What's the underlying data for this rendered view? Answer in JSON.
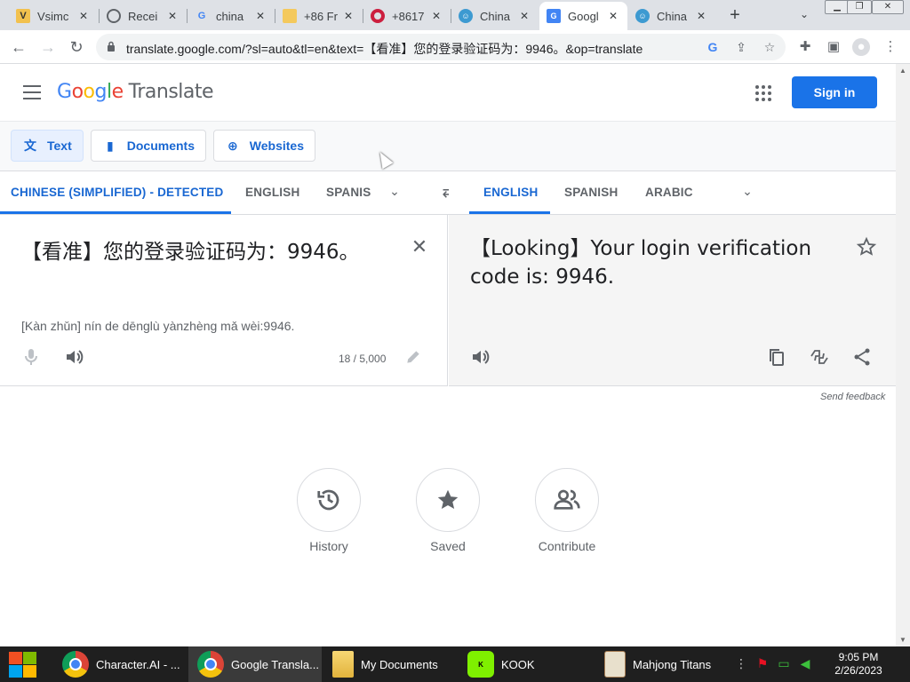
{
  "browser": {
    "tabs": [
      {
        "title": "Vsimc",
        "icon": "vsim-icon"
      },
      {
        "title": "Recei",
        "icon": "globe-icon"
      },
      {
        "title": "china",
        "icon": "google-icon"
      },
      {
        "title": "+86 Fr",
        "icon": "folder-icon"
      },
      {
        "title": "+8617",
        "icon": "opera-icon"
      },
      {
        "title": "China",
        "icon": "chat-icon"
      },
      {
        "title": "Googl",
        "icon": "translate-icon",
        "active": true
      },
      {
        "title": "China",
        "icon": "chat-icon"
      }
    ],
    "url": "translate.google.com/?sl=auto&tl=en&text=【看准】您的登录验证码为：9946。&op=translate"
  },
  "header": {
    "logo_letters": [
      "G",
      "o",
      "o",
      "g",
      "l",
      "e"
    ],
    "product": "Translate",
    "signin_label": "Sign in"
  },
  "modes": {
    "text": "Text",
    "documents": "Documents",
    "websites": "Websites"
  },
  "source_langs": [
    "CHINESE (SIMPLIFIED) - DETECTED",
    "ENGLISH",
    "SPANIS"
  ],
  "target_langs": [
    "ENGLISH",
    "SPANISH",
    "ARABIC"
  ],
  "source": {
    "text": "【看准】您的登录验证码为：9946。",
    "romanization": "[Kàn zhǔn] nín de dēnglù yànzhèng mǎ wèi:9946.",
    "char_count": "18 / 5,000"
  },
  "target": {
    "text": "【Looking】Your login verification code is: 9946."
  },
  "feedback": "Send feedback",
  "shortcuts": {
    "history": "History",
    "saved": "Saved",
    "contribute": "Contribute"
  },
  "taskbar": {
    "items": [
      {
        "label": "Character.AI - ...",
        "icon": "chrome-icon"
      },
      {
        "label": "Google Transla...",
        "icon": "chrome-icon",
        "active": true
      },
      {
        "label": "My Documents",
        "icon": "folder-icon"
      },
      {
        "label": "KOOK",
        "icon": "kook-icon"
      },
      {
        "label": "Mahjong Titans",
        "icon": "mahjong-icon"
      }
    ],
    "time": "9:05 PM",
    "date": "2/26/2023"
  },
  "colors": {
    "accent": "#1a73e8",
    "accent_text": "#1967d2",
    "tabstrip": "#dee1e6",
    "taskbar": "#1f1f1f"
  }
}
